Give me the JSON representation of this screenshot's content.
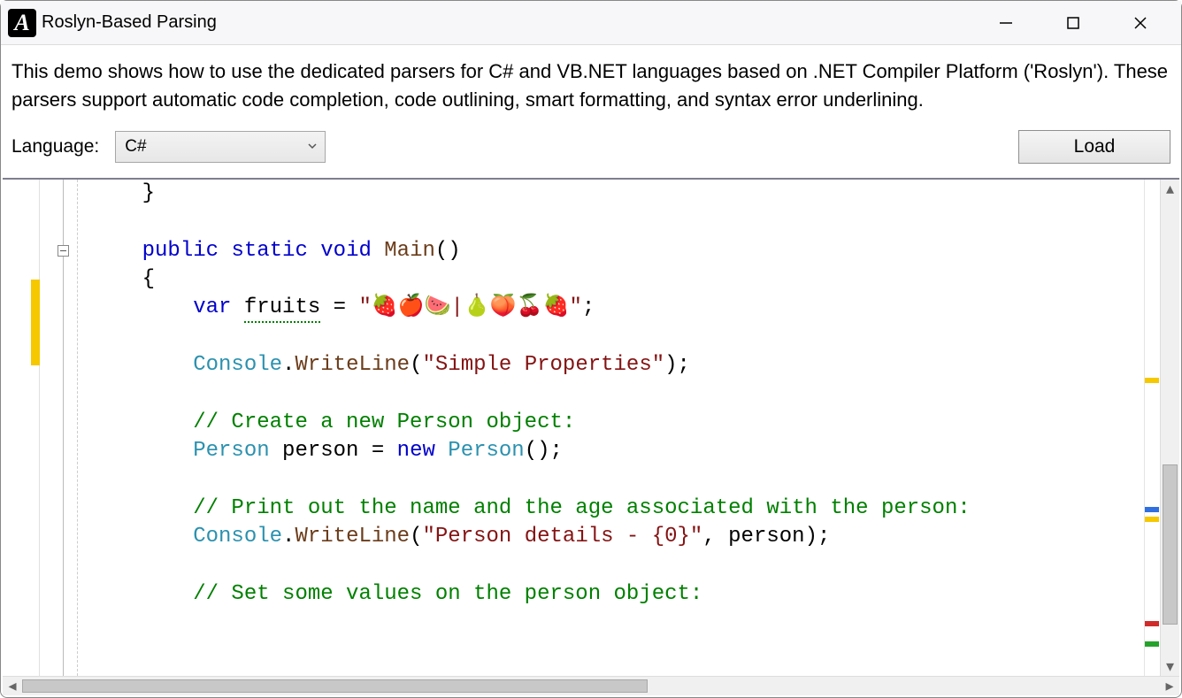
{
  "window": {
    "title": "Roslyn-Based Parsing"
  },
  "description": "This demo shows how to use the dedicated parsers for C# and VB.NET languages based on .NET Compiler Platform ('Roslyn'). These parsers support automatic code completion, code outlining, smart formatting, and syntax error underlining.",
  "toolbar": {
    "language_label": "Language:",
    "language_selected": "C#",
    "load_label": "Load"
  },
  "code": {
    "lines": [
      {
        "indent": 2,
        "tokens": [
          {
            "t": "}",
            "c": "punc"
          }
        ]
      },
      {
        "indent": 0,
        "tokens": []
      },
      {
        "indent": 2,
        "tokens": [
          {
            "t": "public",
            "c": "kw"
          },
          {
            "t": " ",
            "c": ""
          },
          {
            "t": "static",
            "c": "kw"
          },
          {
            "t": " ",
            "c": ""
          },
          {
            "t": "void",
            "c": "kw"
          },
          {
            "t": " ",
            "c": ""
          },
          {
            "t": "Main",
            "c": "method"
          },
          {
            "t": "()",
            "c": "punc"
          }
        ],
        "fold_start": true
      },
      {
        "indent": 2,
        "tokens": [
          {
            "t": "{",
            "c": "punc"
          }
        ]
      },
      {
        "indent": 3,
        "tokens": [
          {
            "t": "var",
            "c": "kw"
          },
          {
            "t": " ",
            "c": ""
          },
          {
            "t": "fruits",
            "c": "var squiggle"
          },
          {
            "t": " = ",
            "c": "punc"
          },
          {
            "t": "\"🍓🍎🍉|🍐🍑🍒🍓\"",
            "c": "str"
          },
          {
            "t": ";",
            "c": "punc"
          }
        ],
        "modified": true
      },
      {
        "indent": 0,
        "tokens": []
      },
      {
        "indent": 3,
        "tokens": [
          {
            "t": "Console",
            "c": "type"
          },
          {
            "t": ".",
            "c": "punc"
          },
          {
            "t": "WriteLine",
            "c": "method"
          },
          {
            "t": "(",
            "c": "punc"
          },
          {
            "t": "\"Simple Properties\"",
            "c": "str"
          },
          {
            "t": ");",
            "c": "punc"
          }
        ]
      },
      {
        "indent": 0,
        "tokens": []
      },
      {
        "indent": 3,
        "tokens": [
          {
            "t": "// Create a new Person object:",
            "c": "cmt"
          }
        ]
      },
      {
        "indent": 3,
        "tokens": [
          {
            "t": "Person",
            "c": "type"
          },
          {
            "t": " person = ",
            "c": "punc"
          },
          {
            "t": "new",
            "c": "kw"
          },
          {
            "t": " ",
            "c": ""
          },
          {
            "t": "Person",
            "c": "type"
          },
          {
            "t": "();",
            "c": "punc"
          }
        ]
      },
      {
        "indent": 0,
        "tokens": []
      },
      {
        "indent": 3,
        "tokens": [
          {
            "t": "// Print out the name and the age associated with the person:",
            "c": "cmt"
          }
        ]
      },
      {
        "indent": 3,
        "tokens": [
          {
            "t": "Console",
            "c": "type"
          },
          {
            "t": ".",
            "c": "punc"
          },
          {
            "t": "WriteLine",
            "c": "method"
          },
          {
            "t": "(",
            "c": "punc"
          },
          {
            "t": "\"Person details - {0}\"",
            "c": "str"
          },
          {
            "t": ", person);",
            "c": "punc"
          }
        ]
      },
      {
        "indent": 0,
        "tokens": []
      },
      {
        "indent": 3,
        "tokens": [
          {
            "t": "// Set some values on the person object:",
            "c": "cmt"
          }
        ]
      }
    ]
  },
  "ruler_marks": [
    {
      "top_pct": 40,
      "color": "#f5c800"
    },
    {
      "top_pct": 66,
      "color": "#2f6fe0"
    },
    {
      "top_pct": 68,
      "color": "#f5c800"
    },
    {
      "top_pct": 89,
      "color": "#d02b2b"
    },
    {
      "top_pct": 93,
      "color": "#25a22a"
    }
  ],
  "vscroll": {
    "thumb_top_pct": 58,
    "thumb_height_pct": 35
  },
  "hscroll": {
    "thumb_left_pct": 0,
    "thumb_width_pct": 55
  }
}
